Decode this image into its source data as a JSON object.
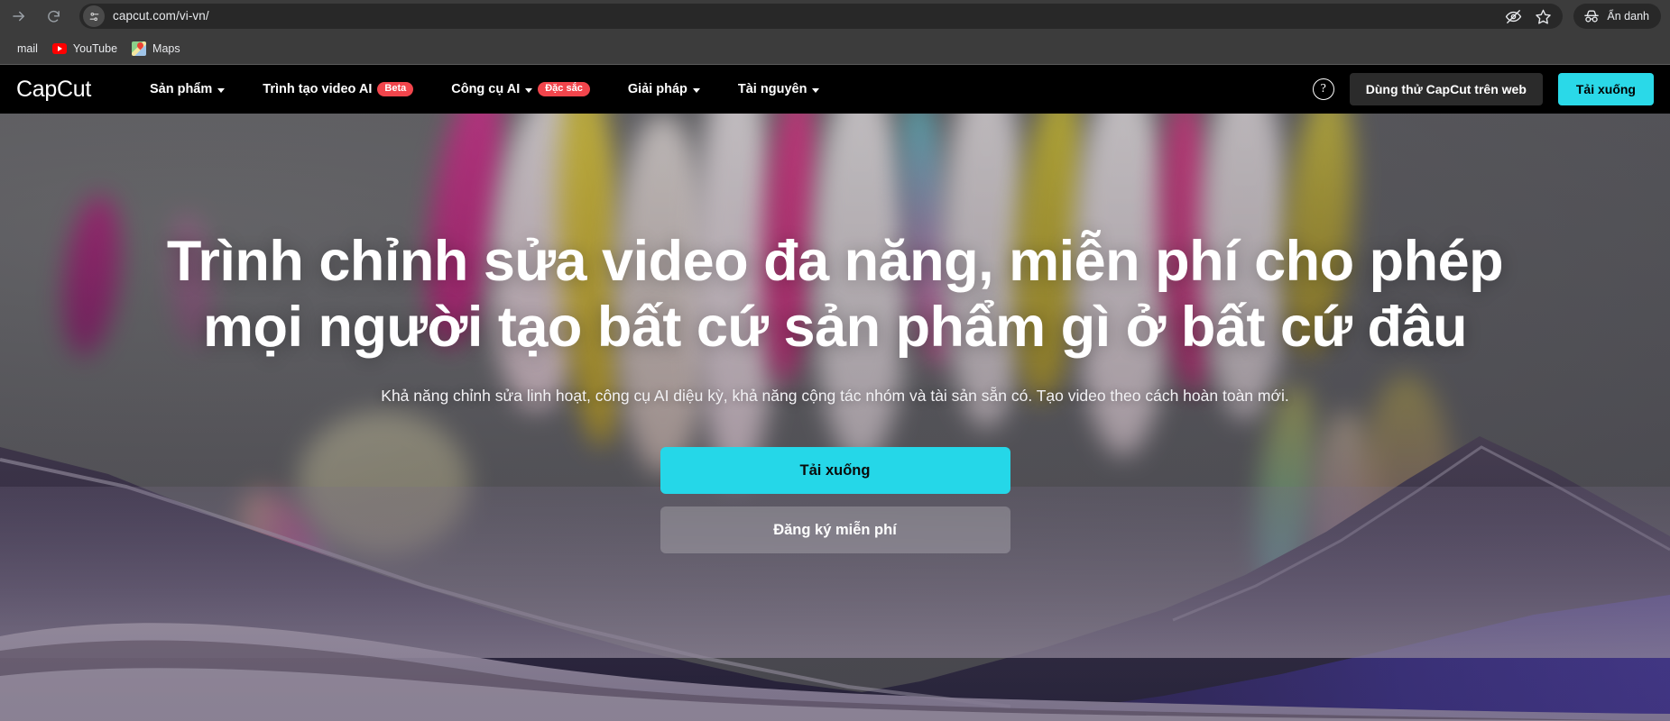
{
  "browser": {
    "url": "capcut.com/vi-vn/",
    "toolbar_icons": {
      "forward": "forward-arrow-icon",
      "reload": "reload-icon",
      "site_info": "site-settings-icon",
      "tracking": "eye-slash-icon",
      "bookmark": "star-icon"
    },
    "profile_label": "Ẩn danh",
    "bookmarks": [
      {
        "label": "mail",
        "icon": "gmail-icon"
      },
      {
        "label": "YouTube",
        "icon": "youtube-icon"
      },
      {
        "label": "Maps",
        "icon": "google-maps-icon"
      }
    ]
  },
  "site_header": {
    "brand": "CapCut",
    "brand_icon": "capcut-logo-icon",
    "nav": [
      {
        "label": "Sản phẩm",
        "caret": true,
        "badge": null
      },
      {
        "label": "Trình tạo video AI",
        "caret": false,
        "badge": "Beta"
      },
      {
        "label": "Công cụ AI",
        "caret": true,
        "badge": "Đặc sắc"
      },
      {
        "label": "Giải pháp",
        "caret": true,
        "badge": null
      },
      {
        "label": "Tài nguyên",
        "caret": true,
        "badge": null
      }
    ],
    "help_icon": "question-mark-icon",
    "try_web_label": "Dùng thử CapCut trên web",
    "download_label": "Tải xuống"
  },
  "hero": {
    "title": "Trình chỉnh sửa video đa năng, miễn phí cho phép mọi người tạo bất cứ sản phẩm gì ở bất cứ đâu",
    "subtitle": "Khả năng chỉnh sửa linh hoạt, công cụ AI diệu kỳ, khả năng cộng tác nhóm và tài sản sẵn có. Tạo video theo cách hoàn toàn mới.",
    "cta_primary": "Tải xuống",
    "cta_secondary": "Đăng ký miễn phí"
  },
  "colors": {
    "accent_cyan": "#25d7e8",
    "badge_red": "#f2454c",
    "header_black": "#000000",
    "chrome_gray": "#3c3c3c",
    "omnibox_gray": "#282828"
  }
}
